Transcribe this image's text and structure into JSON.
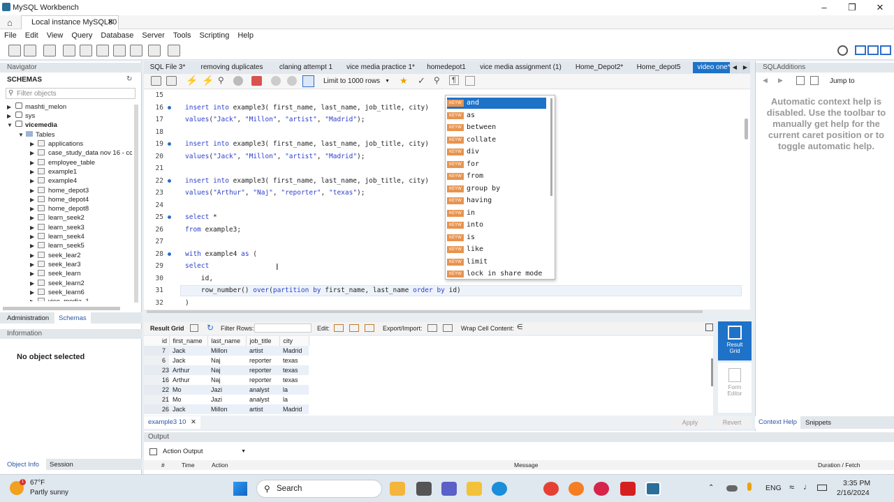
{
  "window": {
    "title": "MySQL Workbench",
    "connection_tab": "Local instance MySQL80"
  },
  "menu": [
    "File",
    "Edit",
    "View",
    "Query",
    "Database",
    "Server",
    "Tools",
    "Scripting",
    "Help"
  ],
  "navigator": {
    "title": "Navigator",
    "schemas_label": "SCHEMAS",
    "filter_placeholder": "Filter objects",
    "schemas": [
      "mashti_melon",
      "sys",
      "vicemedia"
    ],
    "tables_label": "Tables",
    "tables": [
      "applications",
      "case_study_data nov 16 - cc",
      "employee_table",
      "example1",
      "example4",
      "home_depot3",
      "home_depot4",
      "home_depot8",
      "learn_seek2",
      "learn_seek3",
      "learn_seek4",
      "learn_seek5",
      "seek_lear2",
      "seek_lear3",
      "seek_learn",
      "seek_learn2",
      "seek_learn6",
      "vice_media_1"
    ],
    "bottom_tabs": [
      "Administration",
      "Schemas"
    ]
  },
  "information": {
    "title": "Information",
    "message": "No object selected",
    "tabs": [
      "Object Info",
      "Session"
    ]
  },
  "query_tabs": [
    "SQL File 3*",
    "removing duplicates",
    "claning attempt 1",
    "vice media practice 1*",
    "homedepot1",
    "vice media assignment (1)",
    "Home_Depot2*",
    "Home_depot5",
    "video one*"
  ],
  "limit_rows": "Limit to 1000 rows",
  "editor": {
    "lines": [
      {
        "n": "15",
        "t": ""
      },
      {
        "n": "16",
        "t": "insert into example3( first_name, last_name, job_title, city)"
      },
      {
        "n": "17",
        "t": "values(\"Jack\", \"Millon\", \"artist\", \"Madrid\");"
      },
      {
        "n": "18",
        "t": ""
      },
      {
        "n": "19",
        "t": "insert into example3( first_name, last_name, job_title, city)"
      },
      {
        "n": "20",
        "t": "values(\"Jack\", \"Millon\", \"artist\", \"Madrid\");"
      },
      {
        "n": "21",
        "t": ""
      },
      {
        "n": "22",
        "t": "insert into example3( first_name, last_name, job_title, city)"
      },
      {
        "n": "23",
        "t": "values(\"Arthur\", \"Naj\", \"reporter\", \"texas\");"
      },
      {
        "n": "24",
        "t": ""
      },
      {
        "n": "25",
        "t": "select *"
      },
      {
        "n": "26",
        "t": "from example3;"
      },
      {
        "n": "27",
        "t": ""
      },
      {
        "n": "28",
        "t": "with example4 as ("
      },
      {
        "n": "29",
        "t": "select"
      },
      {
        "n": "30",
        "t": "    id,"
      },
      {
        "n": "31",
        "t": "    row_number() over(partition by first_name, last_name order by id)"
      },
      {
        "n": "32",
        "t": ")"
      }
    ]
  },
  "autocomplete": {
    "badge": "KEYW",
    "items": [
      "and",
      "as",
      "between",
      "collate",
      "div",
      "for",
      "from",
      "group by",
      "having",
      "in",
      "into",
      "is",
      "like",
      "limit",
      "lock in share mode"
    ]
  },
  "sql_additions": {
    "title": "SQLAdditions",
    "jump_to": "Jump to",
    "help_text": "Automatic context help is disabled. Use the toolbar to manually get help for the current caret position or to toggle automatic help.",
    "tabs": [
      "Context Help",
      "Snippets"
    ]
  },
  "results": {
    "toolbar": {
      "result_grid": "Result Grid",
      "filter_rows": "Filter Rows:",
      "edit": "Edit:",
      "export_import": "Export/Import:",
      "wrap": "Wrap Cell Content:"
    },
    "columns": [
      "id",
      "first_name",
      "last_name",
      "job_title",
      "city"
    ],
    "rows": [
      [
        "7",
        "Jack",
        "Millon",
        "artist",
        "Madrid"
      ],
      [
        "6",
        "Jack",
        "Naj",
        "reporter",
        "texas"
      ],
      [
        "23",
        "Arthur",
        "Naj",
        "reporter",
        "texas"
      ],
      [
        "16",
        "Arthur",
        "Naj",
        "reporter",
        "texas"
      ],
      [
        "22",
        "Mo",
        "Jazi",
        "analyst",
        "la"
      ],
      [
        "21",
        "Mo",
        "Jazi",
        "analyst",
        "la"
      ],
      [
        "26",
        "Jack",
        "Millon",
        "artist",
        "Madrid"
      ]
    ],
    "tab": "example3 10",
    "side_buttons": [
      "Result Grid",
      "Form Editor"
    ],
    "apply": "Apply",
    "revert": "Revert"
  },
  "output": {
    "title": "Output",
    "mode": "Action Output",
    "columns": [
      "#",
      "Time",
      "Action",
      "Message",
      "Duration / Fetch"
    ]
  },
  "taskbar": {
    "weather_temp": "67°F",
    "weather_desc": "Partly sunny",
    "search": "Search",
    "lang": "ENG",
    "time": "3:35 PM",
    "date": "2/16/2024"
  }
}
